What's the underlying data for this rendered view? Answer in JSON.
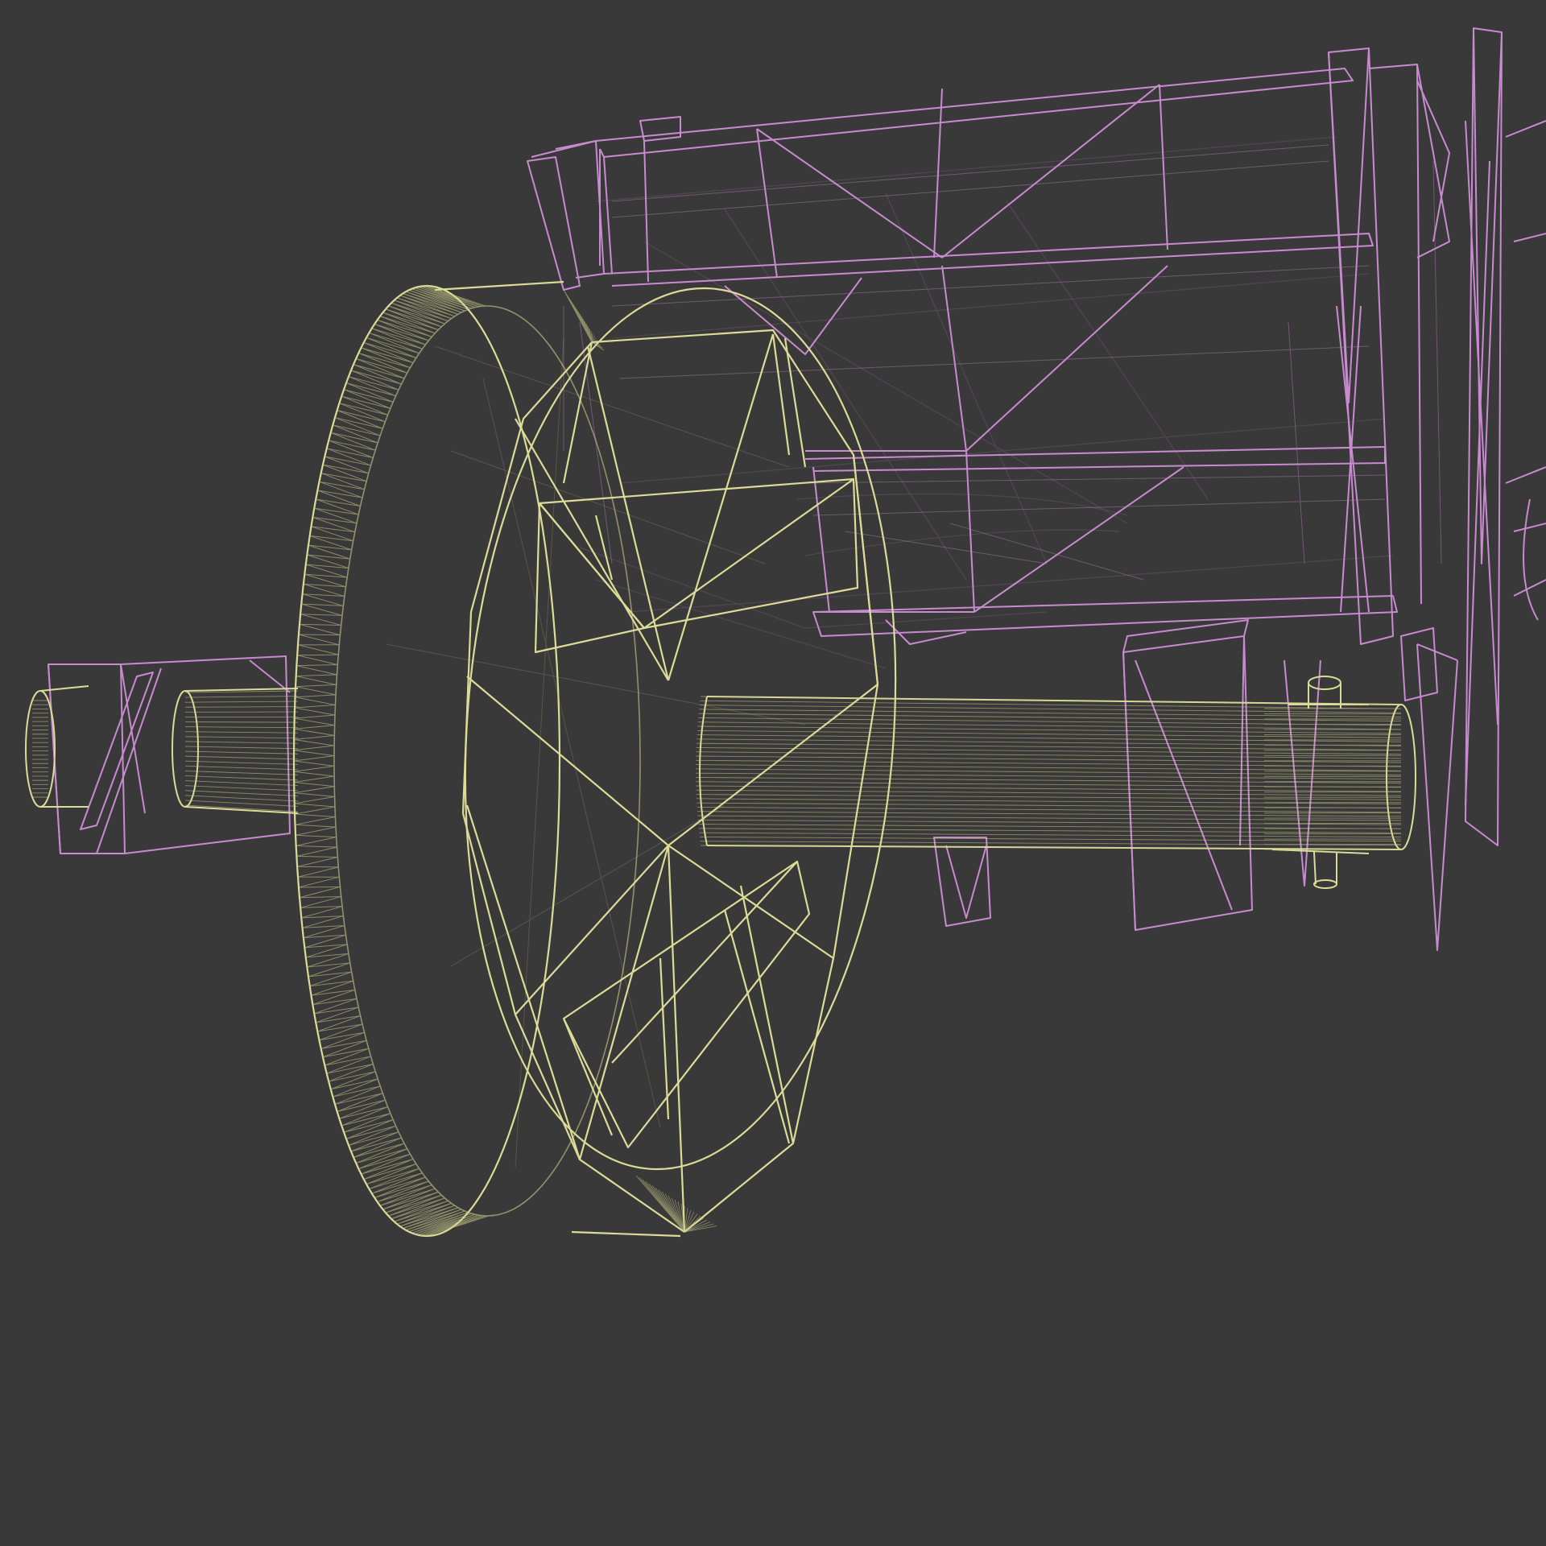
{
  "scene": {
    "background": "#393939",
    "wire_colors": {
      "cart_body": "#c98bd0",
      "wheel_axle": "#dcdb98"
    },
    "objects": [
      {
        "name": "cart body",
        "icon": "wireframe-frame-icon"
      },
      {
        "name": "wheel",
        "icon": "wireframe-wheel-icon"
      },
      {
        "name": "axle",
        "icon": "wireframe-cylinder-icon"
      }
    ]
  }
}
